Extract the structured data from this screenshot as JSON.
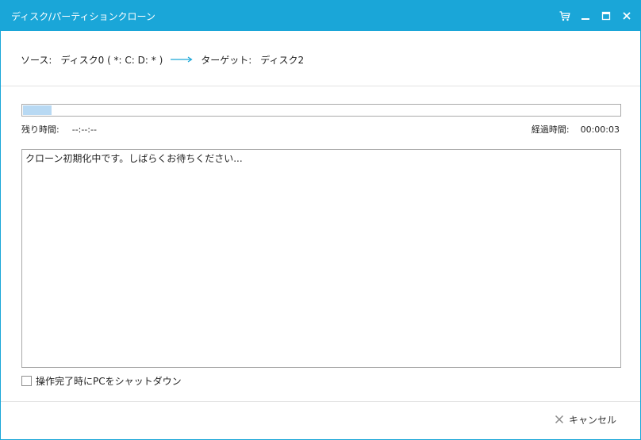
{
  "window": {
    "title": "ディスク/パーティションクローン",
    "accent_color": "#1aa6d8",
    "controls": [
      "cart-icon",
      "minimize-icon",
      "maximize-icon",
      "close-icon"
    ]
  },
  "source": {
    "label": "ソース:",
    "value": "ディスク0 ( *: C: D: * )",
    "target_label": "ターゲット:",
    "target_value": "ディスク2"
  },
  "progress": {
    "percent": 5
  },
  "times": {
    "remaining_label": "残り時間:",
    "remaining_value": "--:--:--",
    "elapsed_label": "経過時間:",
    "elapsed_value": "00:00:03"
  },
  "log": {
    "lines": [
      "クローン初期化中です。しばらくお待ちください..."
    ]
  },
  "shutdown": {
    "label": "操作完了時にPCをシャットダウン",
    "checked": false
  },
  "footer": {
    "cancel_label": "キャンセル"
  }
}
